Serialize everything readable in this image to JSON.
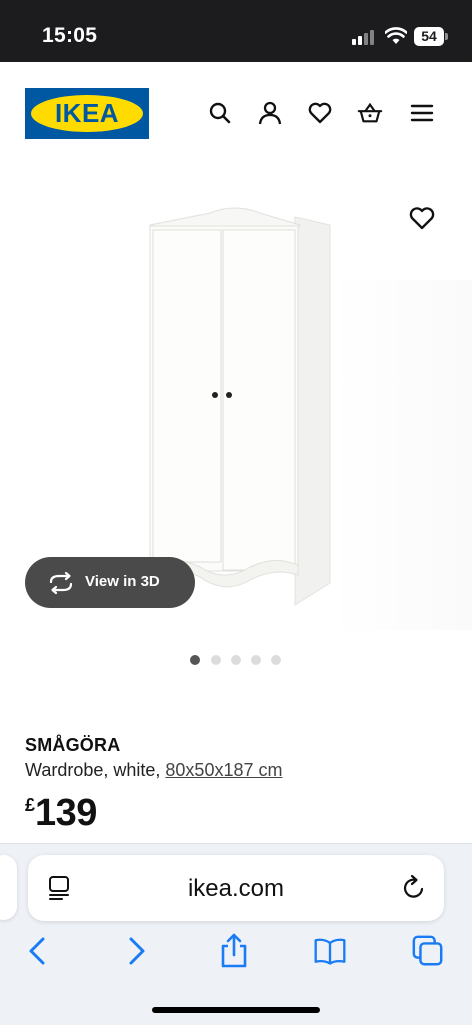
{
  "status_bar": {
    "time": "15:05",
    "battery": "54"
  },
  "header": {
    "logo_text": "IKEA",
    "icons": [
      "search-icon",
      "account-icon",
      "favourites-icon",
      "basket-icon",
      "menu-icon"
    ]
  },
  "gallery": {
    "view_3d_label": "View in 3D",
    "image_count": 5,
    "active_index": 0
  },
  "product": {
    "name": "SMÅGÖRA",
    "description": "Wardrobe, white,",
    "size": "80x50x187 cm",
    "currency": "£",
    "price": "139"
  },
  "safari": {
    "url": "ikea.com",
    "toolbar": [
      "back-icon",
      "forward-icon",
      "share-icon",
      "bookmarks-icon",
      "tabs-icon"
    ]
  },
  "colors": {
    "ikea_blue": "#0058a3",
    "ikea_yellow": "#ffdb00",
    "safari_blue": "#1a7cf4"
  }
}
